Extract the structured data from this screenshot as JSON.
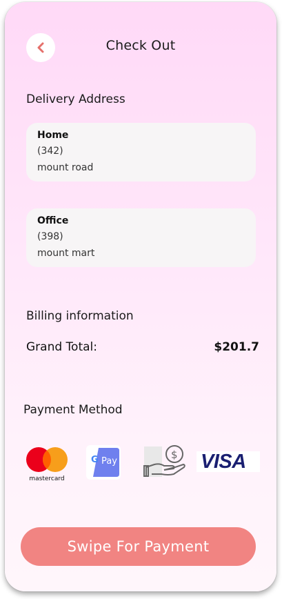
{
  "header": {
    "title": "Check Out",
    "back_icon": "chevron-left-icon"
  },
  "delivery": {
    "title": "Delivery Address",
    "addresses": [
      {
        "label": "Home",
        "line1": "(342)",
        "line2": "mount road"
      },
      {
        "label": "Office",
        "line1": "(398)",
        "line2": "mount mart"
      }
    ]
  },
  "billing": {
    "title": "Billing information",
    "total_label": "Grand Total:",
    "total_value": "$201.7"
  },
  "payment": {
    "title": "Payment Method",
    "methods": [
      {
        "name": "mastercard",
        "icon": "mastercard-icon",
        "text": "mastercard"
      },
      {
        "name": "google-pay",
        "icon": "google-pay-icon",
        "text": "Pay"
      },
      {
        "name": "cash",
        "icon": "cash-hand-icon"
      },
      {
        "name": "visa",
        "icon": "visa-icon",
        "text": "VISA"
      }
    ]
  },
  "action": {
    "swipe_label": "Swipe For Payment"
  },
  "colors": {
    "accent": "#f18482",
    "back_arrow": "#e5706b",
    "card_bg": "#f7f5f6",
    "mc_red": "#eb001b",
    "mc_orange": "#f79e1b",
    "gpay_blue": "#6f80ee",
    "visa_blue": "#1a1f71"
  }
}
